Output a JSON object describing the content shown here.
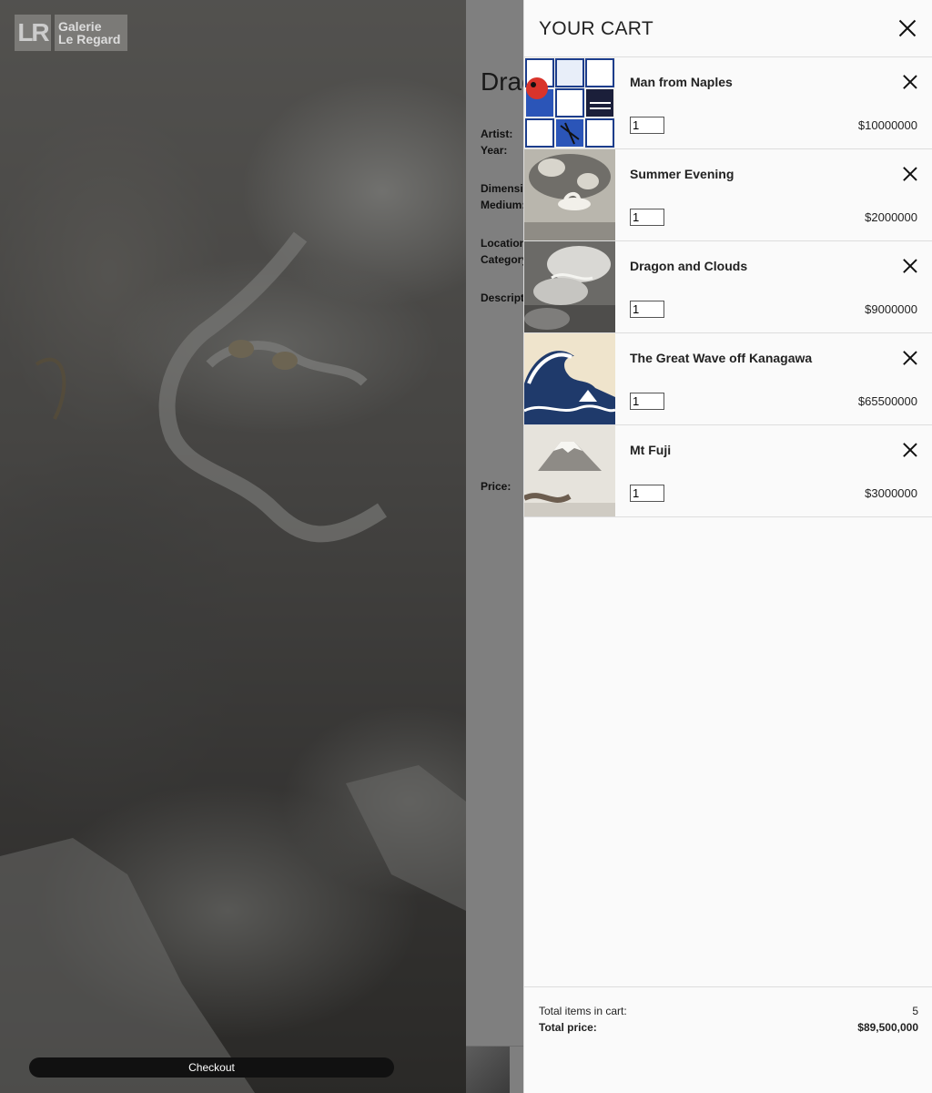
{
  "logo": {
    "mark": "LR",
    "line1": "Galerie",
    "line2": "Le Regard"
  },
  "detail": {
    "title": "Dragon and Clouds",
    "labels": [
      "Artist:",
      "Year:",
      "Dimensions:",
      "Medium:",
      "Location:",
      "Category:",
      "Description:",
      "Price:"
    ]
  },
  "cart": {
    "title": "YOUR CART",
    "items": [
      {
        "title": "Man from Naples",
        "qty": "1",
        "price": "$10000000"
      },
      {
        "title": "Summer Evening",
        "qty": "1",
        "price": "$2000000"
      },
      {
        "title": "Dragon and Clouds",
        "qty": "1",
        "price": "$9000000"
      },
      {
        "title": "The Great Wave off Kanagawa",
        "qty": "1",
        "price": "$65500000"
      },
      {
        "title": "Mt Fuji",
        "qty": "1",
        "price": "$3000000"
      }
    ],
    "total_items_label": "Total items in cart:",
    "total_items": "5",
    "total_price_label": "Total price:",
    "total_price": "$89,500,000",
    "checkout_label": "Checkout"
  }
}
